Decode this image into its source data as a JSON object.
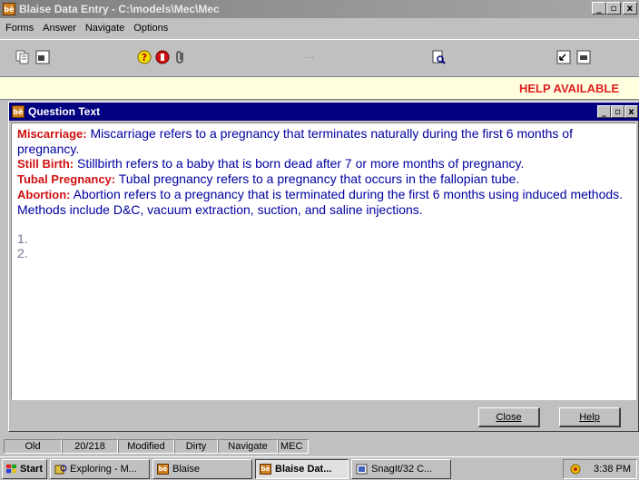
{
  "window": {
    "title": "Blaise Data Entry - C:\\models\\Mec\\Mec",
    "icon_text": "bē",
    "controls": [
      "_",
      "▫",
      "x"
    ]
  },
  "menu": {
    "items": [
      "Forms",
      "Answer",
      "Navigate",
      "Options"
    ]
  },
  "toolbar": {
    "icons": [
      "copy-form-icon",
      "form-icon",
      "help-question-icon",
      "stop-icon",
      "attachment-icon",
      "dots-icon",
      "find-icon",
      "prev-field-icon",
      "next-field-icon"
    ]
  },
  "help_line": {
    "text": "HELP AVAILABLE"
  },
  "question_window": {
    "title": "Question Text",
    "controls": [
      "_",
      "▫",
      "x"
    ],
    "definitions": [
      {
        "term": "Miscarriage:",
        "text": " Miscarriage refers to a pregnancy that terminates naturally during the first 6 months of pregnancy."
      },
      {
        "term": "Still Birth:",
        "text": " Stillbirth refers to a baby that is born dead after 7 or more months of pregnancy."
      },
      {
        "term": "Tubal Pregnancy:",
        "text": " Tubal pregnancy refers to a pregnancy that occurs in the fallopian tube."
      },
      {
        "term": "Abortion:",
        "text": " Abortion refers to a pregnancy that is terminated during the first 6 months using induced methods. Methods include D&C, vacuum extraction, suction, and saline injections."
      }
    ],
    "answers": [
      "1.",
      "2."
    ],
    "close_label": "Close",
    "help_label": "Help"
  },
  "status_bar": {
    "cells": [
      "Old",
      "20/218",
      "Modified",
      "Dirty",
      "Navigate",
      "MEC"
    ]
  },
  "taskbar": {
    "start_label": "Start",
    "tasks": [
      {
        "label": "Exploring - M...",
        "icon": "explorer-icon",
        "active": false
      },
      {
        "label": "Blaise",
        "icon": "blaise-icon",
        "active": false
      },
      {
        "label": "Blaise Dat...",
        "icon": "blaise-icon",
        "active": true
      },
      {
        "label": "SnagIt/32 C...",
        "icon": "snagit-icon",
        "active": false
      }
    ],
    "clock": "3:38 PM"
  }
}
